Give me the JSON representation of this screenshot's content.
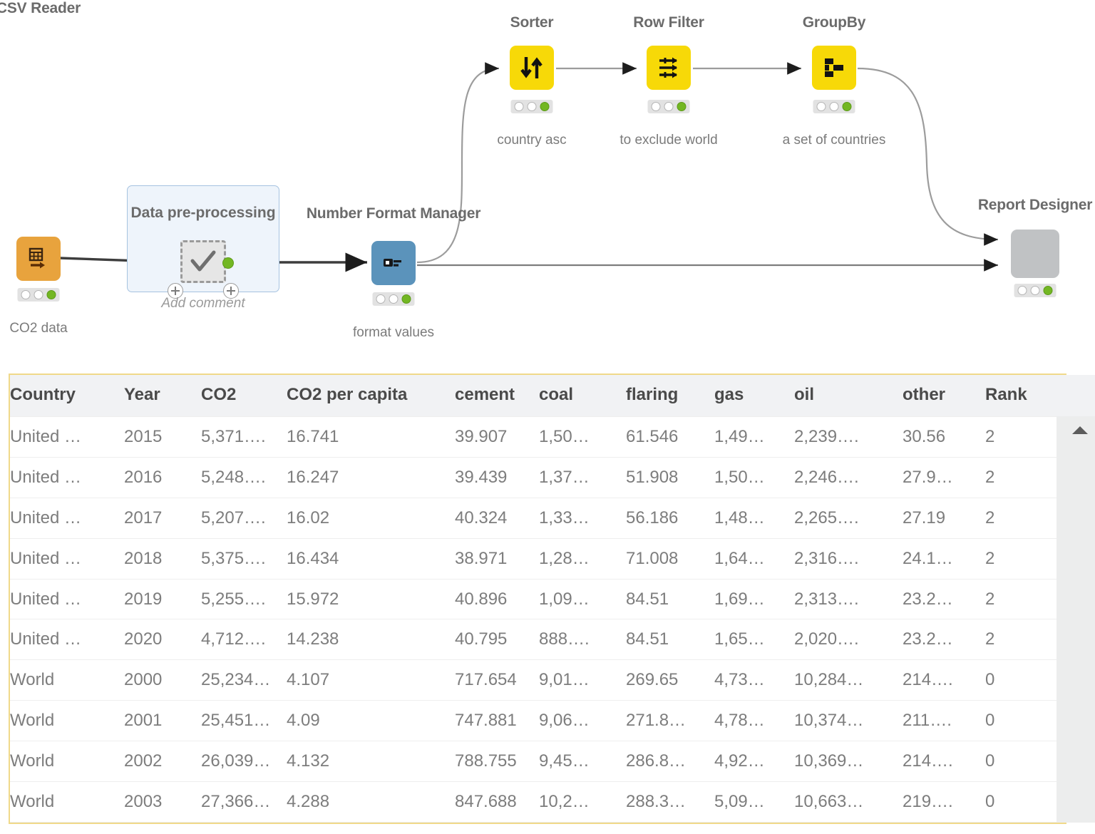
{
  "workflow": {
    "nodes": [
      {
        "id": "csv-reader",
        "title": "CSV Reader",
        "sub": "CO2 data",
        "color": "orange",
        "icon": "csv-reader-icon",
        "leds": [
          "idle",
          "idle",
          "green"
        ]
      },
      {
        "id": "metanode",
        "title": "Data pre-processing",
        "sub": "Add comment",
        "color": "metanode",
        "icon": "metanode-icon",
        "leds": []
      },
      {
        "id": "number-format",
        "title": "Number Format Manager",
        "sub": "format values",
        "color": "blue",
        "icon": "number-format-manager-icon",
        "leds": [
          "idle",
          "idle",
          "green"
        ]
      },
      {
        "id": "sorter",
        "title": "Sorter",
        "sub": "country asc",
        "color": "yellow",
        "icon": "sorter-icon",
        "leds": [
          "idle",
          "idle",
          "green"
        ]
      },
      {
        "id": "row-filter",
        "title": "Row Filter",
        "sub": "to exclude world",
        "color": "yellow",
        "icon": "row-filter-icon",
        "leds": [
          "idle",
          "idle",
          "green"
        ]
      },
      {
        "id": "groupby",
        "title": "GroupBy",
        "sub": "a set of countries",
        "color": "yellow",
        "icon": "groupby-icon",
        "leds": [
          "idle",
          "idle",
          "green"
        ]
      },
      {
        "id": "report",
        "title": "Report Designer",
        "sub": "",
        "color": "grey",
        "icon": "report-designer-icon",
        "leds": [
          "idle",
          "idle",
          "green"
        ]
      }
    ],
    "colors": {
      "yellow": "#f7d908",
      "orange": "#e8a33d",
      "blue": "#5b93bb",
      "grey": "#c0c2c4",
      "metanode_border": "#a6c3e0",
      "metanode_fill": "#eef4fb",
      "led_green": "#73b723",
      "wire": "#9c9c9c",
      "wire_active": "#3d3d3d"
    }
  },
  "table": {
    "border_color": "#f0d98a",
    "scroll_up_icon": "scroll-up-arrow-icon",
    "columns": [
      "Country",
      "Year",
      "CO2",
      "CO2 per capita",
      "cement",
      "coal",
      "flaring",
      "gas",
      "oil",
      "other",
      "Rank"
    ],
    "rows": [
      [
        "United …",
        "2015",
        "5,371….",
        "16.741",
        "39.907",
        "1,50…",
        "61.546",
        "1,49…",
        "2,239….",
        "30.56",
        "2"
      ],
      [
        "United …",
        "2016",
        "5,248….",
        "16.247",
        "39.439",
        "1,37…",
        "51.908",
        "1,50…",
        "2,246….",
        "27.9…",
        "2"
      ],
      [
        "United …",
        "2017",
        "5,207….",
        "16.02",
        "40.324",
        "1,33…",
        "56.186",
        "1,48…",
        "2,265….",
        "27.19",
        "2"
      ],
      [
        "United …",
        "2018",
        "5,375….",
        "16.434",
        "38.971",
        "1,28…",
        "71.008",
        "1,64…",
        "2,316….",
        "24.1…",
        "2"
      ],
      [
        "United …",
        "2019",
        "5,255….",
        "15.972",
        "40.896",
        "1,09…",
        "84.51",
        "1,69…",
        "2,313….",
        "23.2…",
        "2"
      ],
      [
        "United …",
        "2020",
        "4,712….",
        "14.238",
        "40.795",
        "888….",
        "84.51",
        "1,65…",
        "2,020….",
        "23.2…",
        "2"
      ],
      [
        "World",
        "2000",
        "25,234…",
        "4.107",
        "717.654",
        "9,01…",
        "269.65",
        "4,73…",
        "10,284…",
        "214….",
        "0"
      ],
      [
        "World",
        "2001",
        "25,451…",
        "4.09",
        "747.881",
        "9,06…",
        "271.8…",
        "4,78…",
        "10,374…",
        "211….",
        "0"
      ],
      [
        "World",
        "2002",
        "26,039…",
        "4.132",
        "788.755",
        "9,45…",
        "286.8…",
        "4,92…",
        "10,369…",
        "214….",
        "0"
      ],
      [
        "World",
        "2003",
        "27,366…",
        "4.288",
        "847.688",
        "10,2…",
        "288.3…",
        "5,09…",
        "10,663…",
        "219….",
        "0"
      ]
    ]
  }
}
